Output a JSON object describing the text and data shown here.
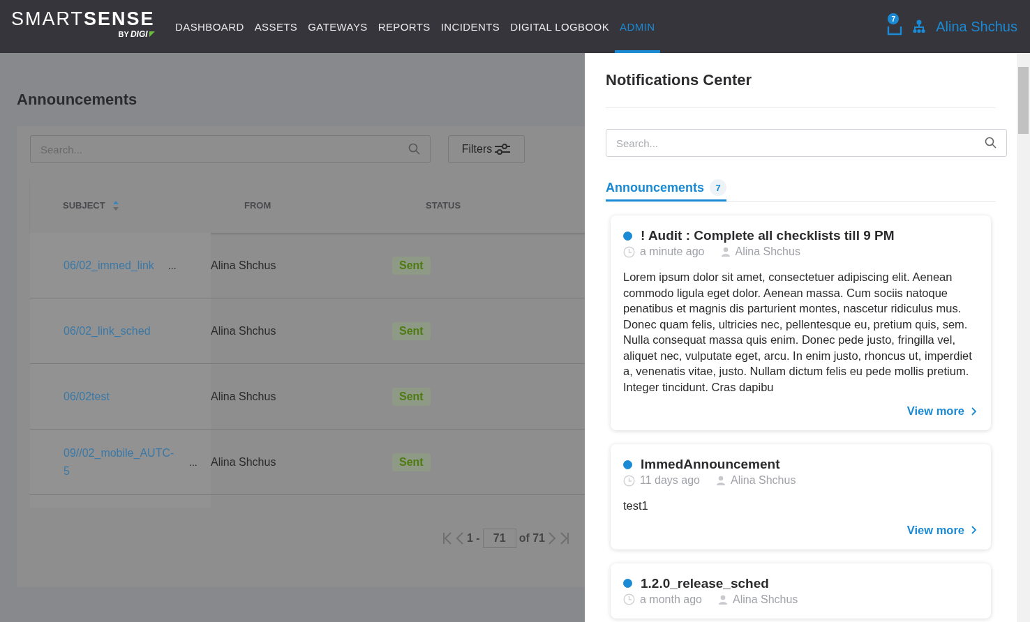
{
  "header": {
    "logo": {
      "main_light": "SMART",
      "main_bold": "SENSE",
      "by": "BY",
      "brand": "DIGI"
    },
    "nav": [
      {
        "label": "DASHBOARD",
        "selected": false
      },
      {
        "label": "ASSETS",
        "selected": false
      },
      {
        "label": "GATEWAYS",
        "selected": false
      },
      {
        "label": "REPORTS",
        "selected": false
      },
      {
        "label": "INCIDENTS",
        "selected": false
      },
      {
        "label": "DIGITAL LOGBOOK",
        "selected": false
      },
      {
        "label": "ADMIN",
        "selected": true
      }
    ],
    "inbox_badge": "7",
    "user": "Alina Shchus"
  },
  "page": {
    "title": "Announcements",
    "search": {
      "placeholder": "Search..."
    },
    "filters_button": "Filters",
    "table": {
      "columns": [
        {
          "label": "SUBJECT",
          "sortable": true
        },
        {
          "label": "FROM",
          "sortable": false
        },
        {
          "label": "STATUS",
          "sortable": false
        }
      ],
      "rows": [
        {
          "subject": "06/02_immed_link",
          "more": "...",
          "from": "Alina Shchus",
          "status": "Sent"
        },
        {
          "subject": "06/02_link_sched",
          "from": "Alina Shchus",
          "status": "Sent"
        },
        {
          "subject": "06/02test",
          "from": "Alina Shchus",
          "status": "Sent"
        },
        {
          "subject": "09//02_mobile_AUTC-5",
          "more": "...",
          "from": "Alina Shchus",
          "status": "Sent"
        }
      ]
    },
    "pagination": {
      "range_start": "1 -",
      "page_size": "71",
      "total": "of 71"
    }
  },
  "notifications": {
    "title": "Notifications Center",
    "search": {
      "placeholder": "Search..."
    },
    "tabs": [
      {
        "label": "Announcements",
        "count": "7",
        "selected": true
      }
    ],
    "items": [
      {
        "unread": true,
        "title": "! Audit : Complete all checklists till 9 PM",
        "time": "a minute ago",
        "author": "Alina Shchus",
        "body": "Lorem ipsum dolor sit amet, consectetuer adipiscing elit. Aenean commodo ligula eget dolor. Aenean massa. Cum sociis natoque penatibus et magnis dis parturient montes, nascetur ridiculus mus. Donec quam felis, ultricies nec, pellentesque eu, pretium quis, sem. Nulla consequat massa quis enim. Donec pede justo, fringilla vel, aliquet nec, vulputate eget, arcu. In enim justo, rhoncus ut, imperdiet a, venenatis vitae, justo. Nullam dictum felis eu pede mollis pretium. Integer tincidunt. Cras dapibu",
        "link": "View more"
      },
      {
        "unread": true,
        "title": "ImmedAnnouncement",
        "time": "11 days ago",
        "author": "Alina Shchus",
        "body": "test1",
        "link": "View more"
      },
      {
        "unread": true,
        "title": "1.2.0_release_sched",
        "time": "a month ago",
        "author": "Alina Shchus"
      }
    ]
  }
}
